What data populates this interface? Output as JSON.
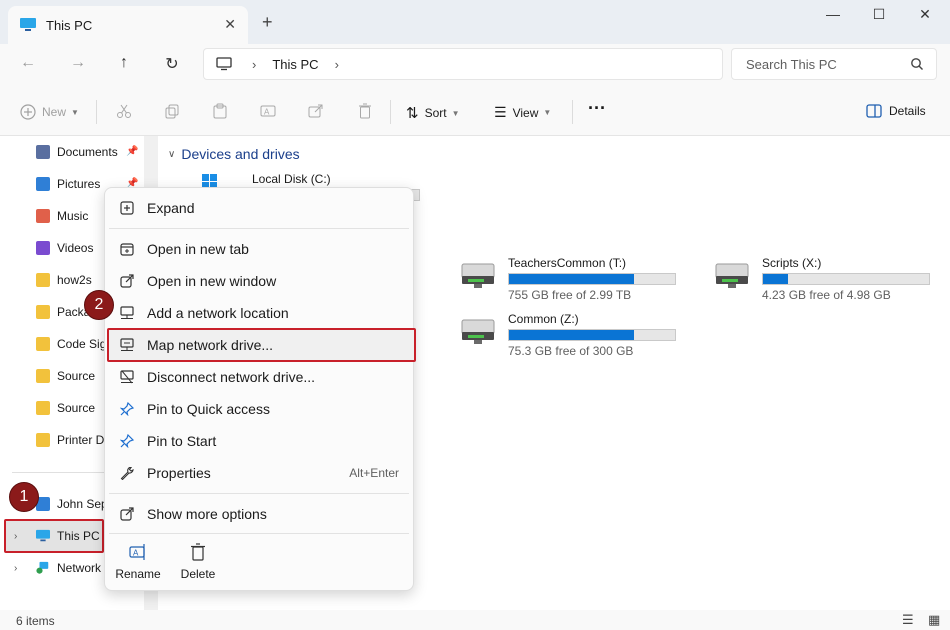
{
  "window": {
    "tab_title": "This PC",
    "new_tab_glyph": "+",
    "close_tab_glyph": "✕",
    "minimize_glyph": "—",
    "maximize_glyph": "☐",
    "close_glyph": "✕"
  },
  "address": {
    "crumb": "This PC",
    "search_placeholder": "Search This PC"
  },
  "toolbar": {
    "new_label": "New",
    "sort_label": "Sort",
    "view_label": "View",
    "more_glyph": "···",
    "details_label": "Details"
  },
  "sidebar": {
    "quick": [
      {
        "label": "Documents",
        "color": "#5a6fa0"
      },
      {
        "label": "Pictures",
        "color": "#2f7fd6"
      },
      {
        "label": "Music",
        "color": "#e0604a"
      },
      {
        "label": "Videos",
        "color": "#7a4bd0"
      },
      {
        "label": "how2s",
        "color": "#f2c23c"
      },
      {
        "label": "Packag",
        "color": "#f2c23c"
      },
      {
        "label": "Code Sig",
        "color": "#f2c23c"
      },
      {
        "label": "Source",
        "color": "#f2c23c"
      },
      {
        "label": "Source",
        "color": "#f2c23c"
      },
      {
        "label": "Printer D",
        "color": "#f2c23c"
      }
    ],
    "user": "John Sep",
    "this_pc": "This PC",
    "network": "Network"
  },
  "main": {
    "group_title": "Devices and drives",
    "drives": [
      {
        "name": "Local Disk (C:)",
        "free": "",
        "fill": 0.0
      },
      {
        "name": "TeachersCommon (T:)",
        "free": "755 GB free of 2.99 TB",
        "fill": 0.75
      },
      {
        "name": "Scripts (X:)",
        "free": "4.23 GB free of 4.98 GB",
        "fill": 0.15
      },
      {
        "name": "Common (Z:)",
        "free": "75.3 GB free of 300 GB",
        "fill": 0.75
      }
    ]
  },
  "context_menu": {
    "items": [
      {
        "label": "Expand"
      },
      {
        "label": "Open in new tab"
      },
      {
        "label": "Open in new window"
      },
      {
        "label": "Add a network location"
      },
      {
        "label": "Map network drive..."
      },
      {
        "label": "Disconnect network drive..."
      },
      {
        "label": "Pin to Quick access"
      },
      {
        "label": "Pin to Start"
      },
      {
        "label": "Properties",
        "shortcut": "Alt+Enter"
      },
      {
        "label": "Show more options"
      }
    ],
    "rename_label": "Rename",
    "delete_label": "Delete"
  },
  "badges": {
    "step1": "1",
    "step2": "2"
  },
  "status": {
    "items_count": "6 items"
  },
  "colors": {
    "accent": "#0a74d4",
    "highlight": "#c8202a",
    "badge": "#8b1a1a"
  }
}
